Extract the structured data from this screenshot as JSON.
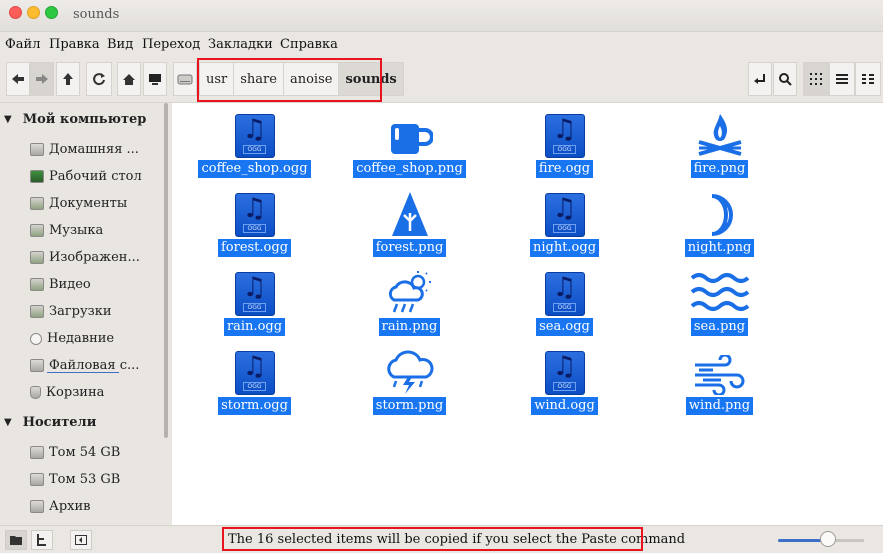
{
  "window": {
    "title": "sounds"
  },
  "menu": [
    "Файл",
    "Правка",
    "Вид",
    "Переход",
    "Закладки",
    "Справка"
  ],
  "breadcrumb": [
    "usr",
    "share",
    "anoise",
    "sounds"
  ],
  "sidebar": {
    "sections": [
      {
        "title": "Мой компьютер",
        "items": [
          "Домашняя ...",
          "Рабочий стол",
          "Документы",
          "Музыка",
          "Изображен...",
          "Видео",
          "Загрузки",
          "Недавние",
          "Файловая с...",
          "Корзина"
        ]
      },
      {
        "title": "Носители",
        "items": [
          "Том 54 GB",
          "Том 53 GB",
          "Архив"
        ]
      }
    ]
  },
  "files": [
    {
      "name": "coffee_shop.ogg",
      "icon": "audio-ogg-icon"
    },
    {
      "name": "coffee_shop.png",
      "icon": "coffee-cup-icon"
    },
    {
      "name": "fire.ogg",
      "icon": "audio-ogg-icon"
    },
    {
      "name": "fire.png",
      "icon": "campfire-icon"
    },
    {
      "name": "forest.ogg",
      "icon": "audio-ogg-icon"
    },
    {
      "name": "forest.png",
      "icon": "tree-icon"
    },
    {
      "name": "night.ogg",
      "icon": "audio-ogg-icon"
    },
    {
      "name": "night.png",
      "icon": "moon-icon"
    },
    {
      "name": "rain.ogg",
      "icon": "audio-ogg-icon"
    },
    {
      "name": "rain.png",
      "icon": "rain-cloud-icon"
    },
    {
      "name": "sea.ogg",
      "icon": "audio-ogg-icon"
    },
    {
      "name": "sea.png",
      "icon": "waves-icon"
    },
    {
      "name": "storm.ogg",
      "icon": "audio-ogg-icon"
    },
    {
      "name": "storm.png",
      "icon": "storm-cloud-icon"
    },
    {
      "name": "wind.ogg",
      "icon": "audio-ogg-icon"
    },
    {
      "name": "wind.png",
      "icon": "wind-icon"
    }
  ],
  "ogg_badge": "OGG",
  "status": {
    "text": "The 16 selected items will be copied if you select the Paste command",
    "zoom": 0.58
  },
  "colors": {
    "selection": "#1976f2",
    "icon_blue": "#1b6fe6",
    "highlight": "#e8131d"
  }
}
